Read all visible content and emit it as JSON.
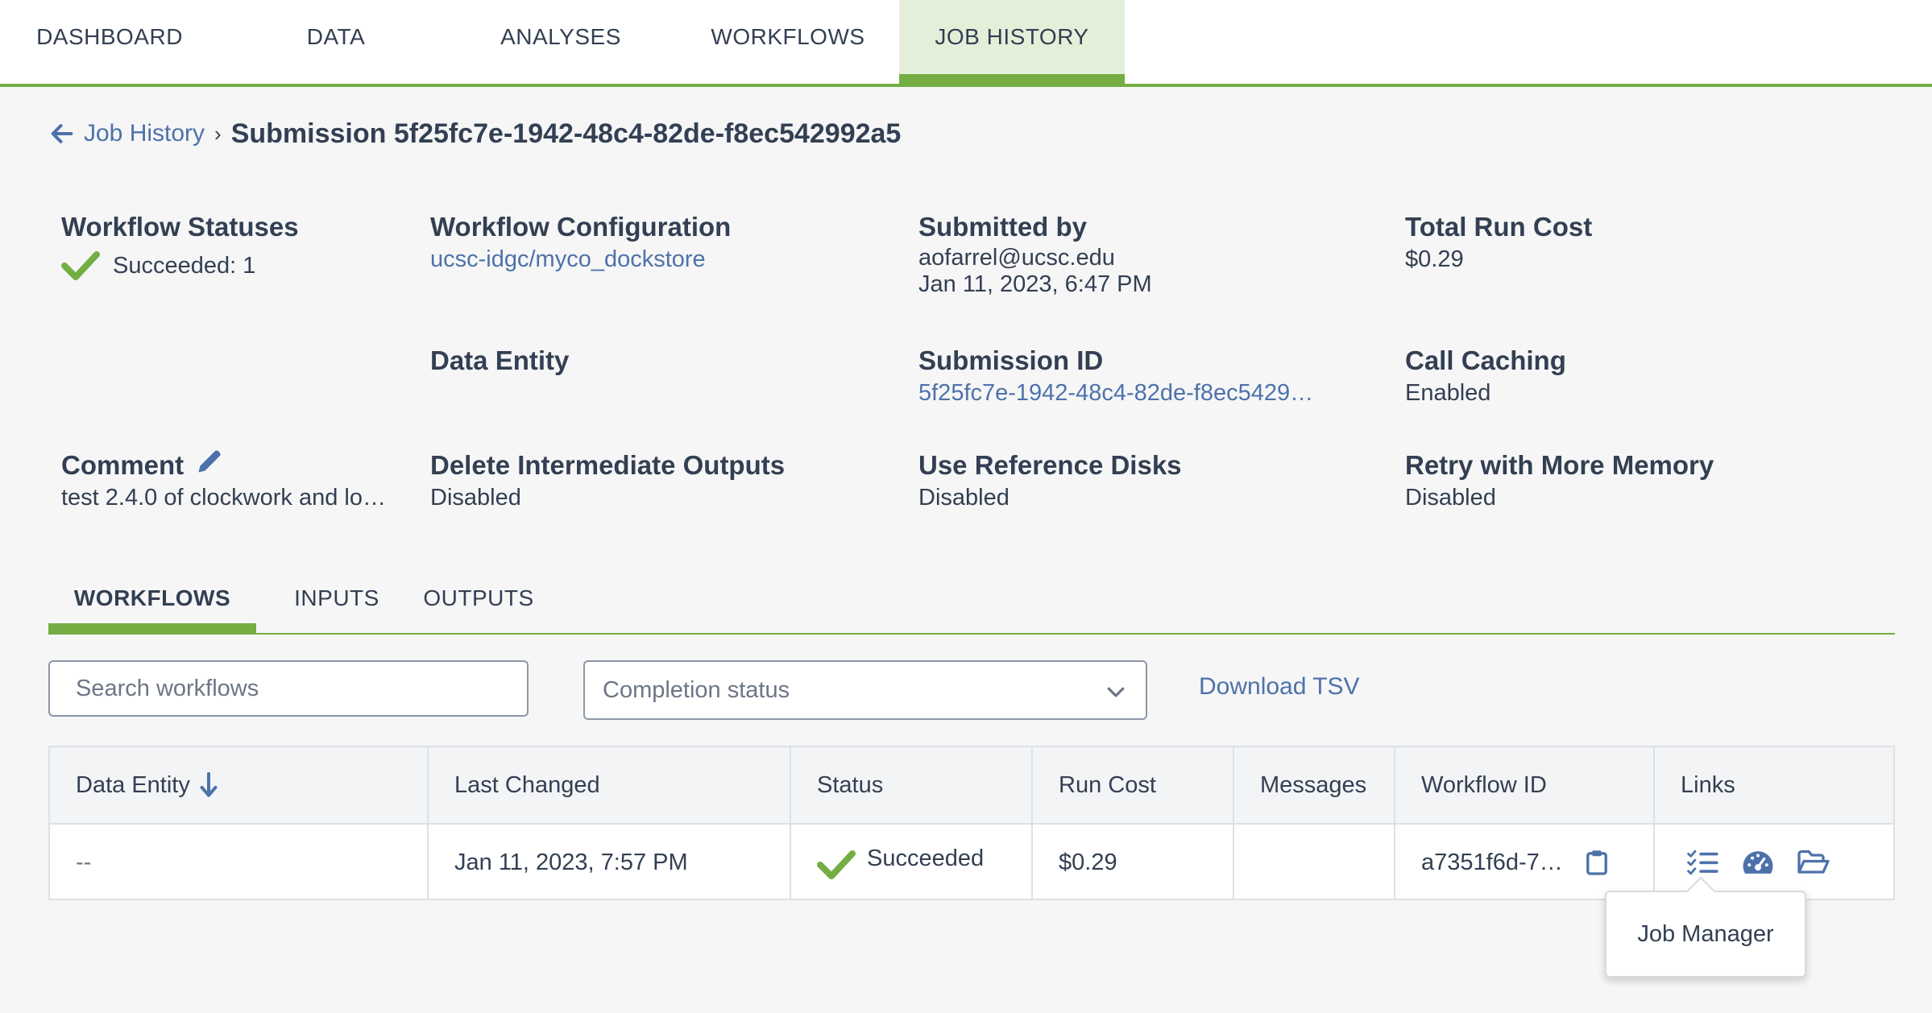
{
  "nav": {
    "tabs": [
      {
        "label": "DASHBOARD"
      },
      {
        "label": "DATA"
      },
      {
        "label": "ANALYSES"
      },
      {
        "label": "WORKFLOWS"
      },
      {
        "label": "JOB HISTORY",
        "active": true
      }
    ]
  },
  "breadcrumb": {
    "back_label": "Job History",
    "separator": "›",
    "title": "Submission 5f25fc7e-1942-48c4-82de-f8ec542992a5"
  },
  "info": {
    "workflow_statuses": {
      "label": "Workflow Statuses",
      "value": "Succeeded: 1"
    },
    "workflow_configuration": {
      "label": "Workflow Configuration",
      "value": "ucsc-idgc/myco_dockstore"
    },
    "submitted_by": {
      "label": "Submitted by",
      "user": "aofarrel@ucsc.edu",
      "date": "Jan 11, 2023, 6:47 PM"
    },
    "total_run_cost": {
      "label": "Total Run Cost",
      "value": "$0.29"
    },
    "data_entity": {
      "label": "Data Entity"
    },
    "submission_id": {
      "label": "Submission ID",
      "value": "5f25fc7e-1942-48c4-82de-f8ec5429…"
    },
    "call_caching": {
      "label": "Call Caching",
      "value": "Enabled"
    },
    "comment": {
      "label": "Comment",
      "value": "test 2.4.0 of clockwork and lo…"
    },
    "delete_intermediate": {
      "label": "Delete Intermediate Outputs",
      "value": "Disabled"
    },
    "use_reference_disks": {
      "label": "Use Reference Disks",
      "value": "Disabled"
    },
    "retry_memory": {
      "label": "Retry with More Memory",
      "value": "Disabled"
    }
  },
  "subtabs": [
    {
      "label": "WORKFLOWS",
      "active": true
    },
    {
      "label": "INPUTS"
    },
    {
      "label": "OUTPUTS"
    }
  ],
  "controls": {
    "search_placeholder": "Search workflows",
    "completion_status": "Completion status",
    "download": "Download TSV"
  },
  "table": {
    "headers": [
      "Data Entity",
      "Last Changed",
      "Status",
      "Run Cost",
      "Messages",
      "Workflow ID",
      "Links"
    ],
    "rows": [
      {
        "data_entity": "--",
        "last_changed": "Jan 11, 2023, 7:57 PM",
        "status": "Succeeded",
        "run_cost": "$0.29",
        "messages": "",
        "workflow_id": "a7351f6d-7…"
      }
    ]
  },
  "tooltip": {
    "text": "Job Manager"
  },
  "colors": {
    "accent_green": "#74ae43",
    "link_blue": "#4d72aa",
    "text": "#333f52",
    "success": "#74ae43"
  },
  "icons": {
    "back": "arrow-left-icon",
    "edit": "pencil-icon",
    "success": "check-icon",
    "sort": "arrow-down-icon",
    "dropdown": "chevron-down-icon",
    "clipboard": "clipboard-icon",
    "job_manager": "tasks-list-icon",
    "dashboard": "gauge-icon",
    "folder": "folder-open-icon"
  }
}
